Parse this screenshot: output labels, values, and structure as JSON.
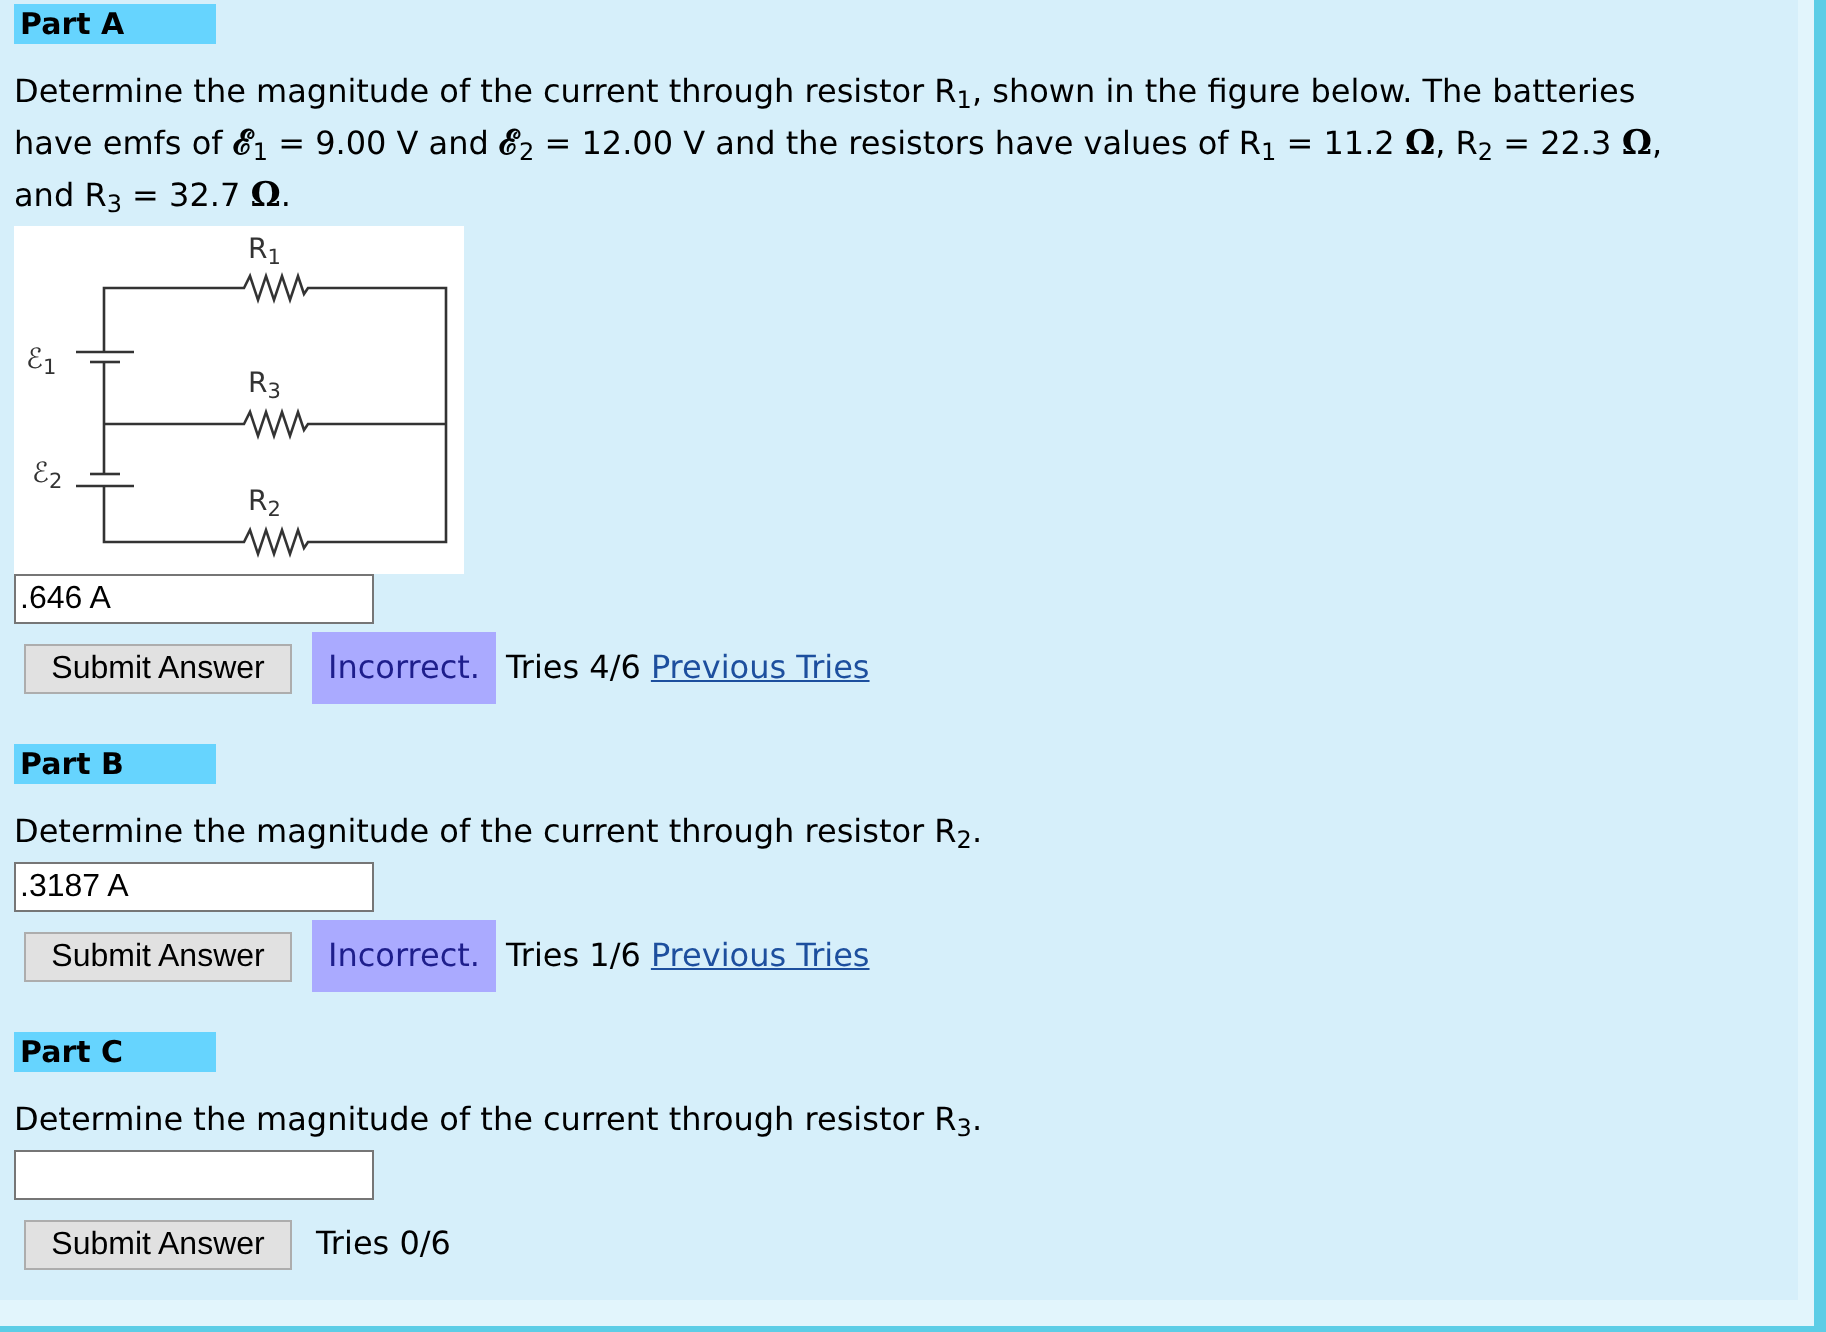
{
  "parts": [
    {
      "title": "Part A",
      "question": "Determine the magnitude of the current through resistor R$_{1}$, shown in the figure below. The batteries have emfs of **ℰ**$_{1}$ = 9.00 V and **ℰ**$_{2}$ = 12.00 V and the resistors have values of R$_{1}$ = 11.2 **Ω**, R$_{2}$ = 22.3 **Ω**, and R$_{3}$ = 32.7 **Ω**.",
      "figure": {
        "resistors": [
          {
            "label": "R$_{1}$"
          },
          {
            "label": "R$_{3}$"
          },
          {
            "label": "R$_{2}$"
          }
        ],
        "batteries": [
          {
            "label": "ℰ$_{1}$"
          },
          {
            "label": "ℰ$_{2}$"
          }
        ]
      },
      "answer_value": ".646 A",
      "submit": "Submit Answer",
      "feedback": {
        "kind": "incorrect",
        "text": "Incorrect."
      },
      "tries": "Tries 4/6",
      "previous_tries": "Previous Tries"
    },
    {
      "title": "Part B",
      "question": "Determine the magnitude of the current through resistor R$_{2}$.",
      "answer_value": ".3187 A",
      "submit": "Submit Answer",
      "feedback": {
        "kind": "incorrect",
        "text": "Incorrect."
      },
      "tries": "Tries 1/6",
      "previous_tries": "Previous Tries"
    },
    {
      "title": "Part C",
      "question": "Determine the magnitude of the current through resistor R$_{3}$.",
      "submit": "Submit Answer",
      "tries": "Tries 0/6"
    }
  ]
}
